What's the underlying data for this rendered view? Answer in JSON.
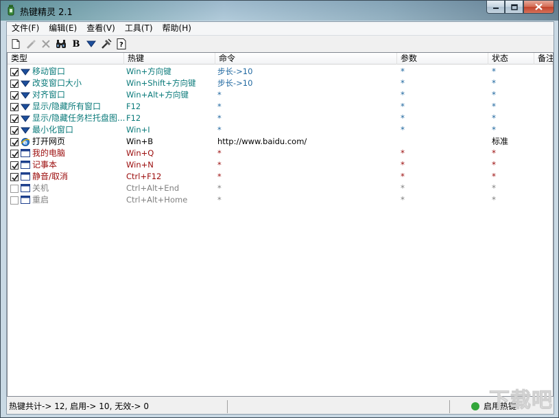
{
  "window": {
    "title": "热键精灵 2.1"
  },
  "menu": [
    "文件(F)",
    "编辑(E)",
    "查看(V)",
    "工具(T)",
    "帮助(H)"
  ],
  "toolbar": [
    {
      "name": "new-icon"
    },
    {
      "name": "edit-icon"
    },
    {
      "name": "delete-icon"
    },
    {
      "name": "find-icon"
    },
    {
      "name": "bold-icon",
      "glyph": "B"
    },
    {
      "name": "arrow-down-icon"
    },
    {
      "name": "tools-icon"
    },
    {
      "name": "help-icon",
      "glyph": "?"
    }
  ],
  "columns": [
    "类型",
    "热键",
    "命令",
    "参数",
    "状态",
    "备注"
  ],
  "rows": [
    {
      "checked": true,
      "icon": "arrow",
      "name": "移动窗口",
      "hotkey": "Win+方向键",
      "command": "步长->10",
      "param": "*",
      "status": "*",
      "color": "teal",
      "cmdColor": "teal"
    },
    {
      "checked": true,
      "icon": "arrow",
      "name": "改变窗口大小",
      "hotkey": "Win+Shift+方向键",
      "command": "步长->10",
      "param": "*",
      "status": "*",
      "color": "teal",
      "cmdColor": "teal"
    },
    {
      "checked": true,
      "icon": "arrow",
      "name": "对齐窗口",
      "hotkey": "Win+Alt+方向键",
      "command": "*",
      "param": "*",
      "status": "*",
      "color": "teal",
      "cmdColor": "teal"
    },
    {
      "checked": true,
      "icon": "arrow",
      "name": "显示/隐藏所有窗口",
      "hotkey": "F12",
      "command": "*",
      "param": "*",
      "status": "*",
      "color": "teal",
      "cmdColor": "teal"
    },
    {
      "checked": true,
      "icon": "arrow",
      "name": "显示/隐藏任务栏托盘图...",
      "hotkey": "F12",
      "command": "*",
      "param": "*",
      "status": "*",
      "color": "teal",
      "cmdColor": "teal"
    },
    {
      "checked": true,
      "icon": "arrow",
      "name": "最小化窗口",
      "hotkey": "Win+I",
      "command": "*",
      "param": "*",
      "status": "*",
      "color": "teal",
      "cmdColor": "teal"
    },
    {
      "checked": true,
      "icon": "ie",
      "name": "打开网页",
      "hotkey": "Win+B",
      "command": "http://www.baidu.com/",
      "param": "",
      "status": "标准",
      "color": "blk",
      "cmdColor": "blk"
    },
    {
      "checked": true,
      "icon": "window",
      "name": "我的电脑",
      "hotkey": "Win+Q",
      "command": "*",
      "param": "*",
      "status": "*",
      "color": "red",
      "cmdColor": "red"
    },
    {
      "checked": true,
      "icon": "window",
      "name": "记事本",
      "hotkey": "Win+N",
      "command": "*",
      "param": "*",
      "status": "*",
      "color": "red",
      "cmdColor": "red"
    },
    {
      "checked": true,
      "icon": "window",
      "name": "静音/取消",
      "hotkey": "Ctrl+F12",
      "command": "*",
      "param": "*",
      "status": "*",
      "color": "red",
      "cmdColor": "red"
    },
    {
      "checked": false,
      "icon": "window",
      "name": "关机",
      "hotkey": "Ctrl+Alt+End",
      "command": "*",
      "param": "*",
      "status": "*",
      "color": "gray",
      "cmdColor": "gray"
    },
    {
      "checked": false,
      "icon": "window",
      "name": "重启",
      "hotkey": "Ctrl+Alt+Home",
      "command": "*",
      "param": "*",
      "status": "*",
      "color": "gray",
      "cmdColor": "gray"
    }
  ],
  "statusbar": {
    "summary": "热键共计-> 12, 启用-> 10, 无效-> 0",
    "state": "启用热键"
  },
  "watermark": "下载吧",
  "colors": {
    "teal": "#0a7a7a",
    "red": "#9a0a0a",
    "gray": "#808080",
    "arrow": "#1d4f9c"
  }
}
